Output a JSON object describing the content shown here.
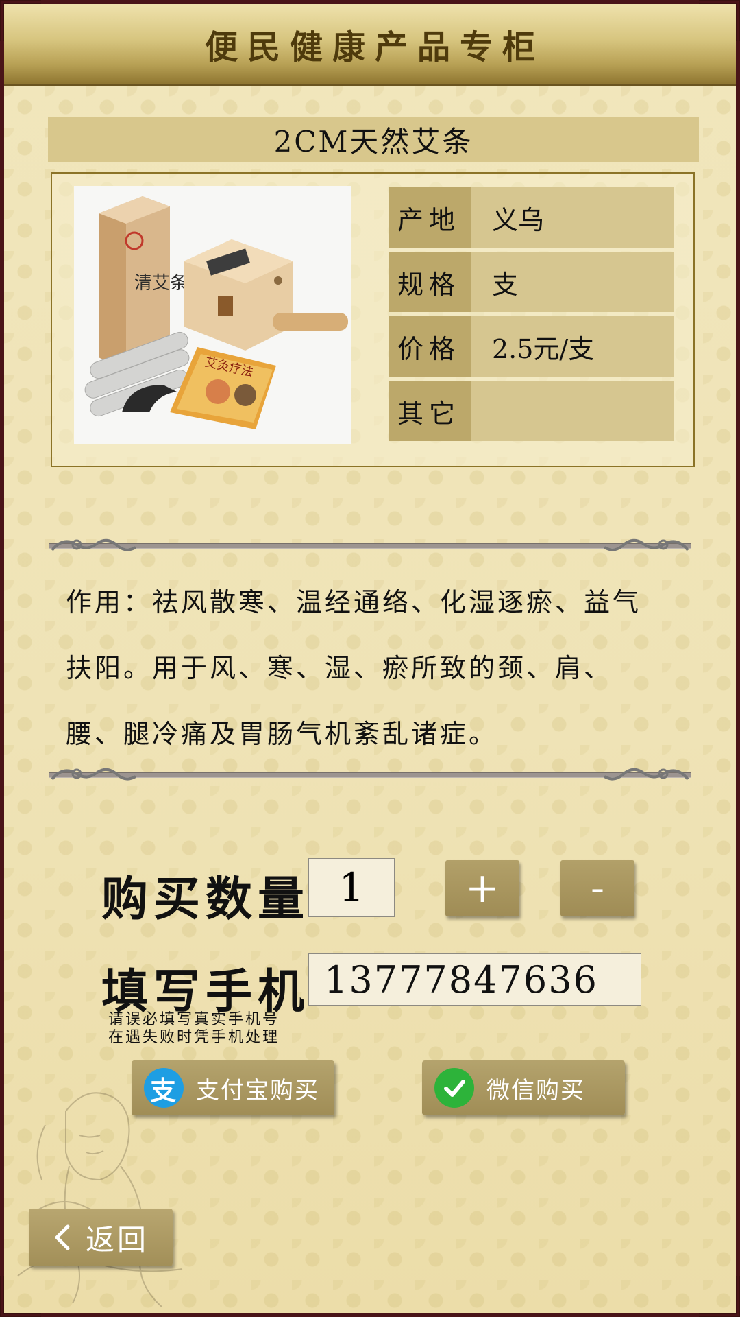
{
  "header": {
    "title": "便民健康产品专柜"
  },
  "product": {
    "title": "2CM天然艾条",
    "attributes": [
      {
        "key": "产地",
        "value": "义乌"
      },
      {
        "key": "规格",
        "value": "支"
      },
      {
        "key": "价格",
        "value": "2.5元/支"
      },
      {
        "key": "其它",
        "value": ""
      }
    ],
    "image_box_label": "清艾条",
    "image_book_label": "艾灸疗法"
  },
  "description": "作用：祛风散寒、温经通络、化湿逐瘀、益气扶阳。用于风、寒、湿、瘀所致的颈、肩、腰、腿冷痛及胃肠气机紊乱诸症。",
  "purchase": {
    "quantity_label": "购买数量",
    "quantity_value": "1",
    "plus_label": "+",
    "minus_label": "-",
    "phone_label": "填写手机",
    "phone_value": "13777847636",
    "phone_note_line1": "请误必填写真实手机号",
    "phone_note_line2": "在遇失败时凭手机处理"
  },
  "payment": {
    "alipay_label": "支付宝购买",
    "alipay_icon": "支",
    "wechat_label": "微信购买"
  },
  "nav": {
    "back_label": "返回"
  },
  "colors": {
    "frame": "#4a1418",
    "button": "#a8955d",
    "alipay": "#1e9ee3",
    "wechat": "#2db33a"
  }
}
